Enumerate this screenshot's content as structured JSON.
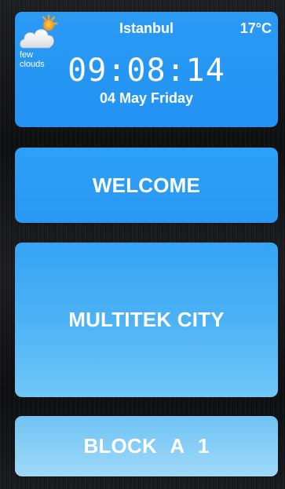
{
  "weather": {
    "icon": "few-clouds-icon",
    "description": "few clouds",
    "city": "Istanbul",
    "temperature": "17°C",
    "time": "09:08:14",
    "date": "04 May Friday"
  },
  "buttons": {
    "welcome": "WELCOME",
    "multitek": "MULTITEK CITY",
    "block": "BLOCK A  1"
  },
  "colors": {
    "weather_card": "#2293f4",
    "welcome_button": "#2a98f4",
    "multitek_button": "#4cb2f5",
    "block_button": "#9fd9f8",
    "text": "#ffffff"
  }
}
